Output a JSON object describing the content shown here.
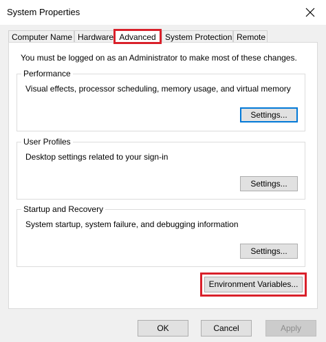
{
  "window": {
    "title": "System Properties"
  },
  "tabs": [
    {
      "label": "Computer Name"
    },
    {
      "label": "Hardware"
    },
    {
      "label": "Advanced"
    },
    {
      "label": "System Protection"
    },
    {
      "label": "Remote"
    }
  ],
  "advanced": {
    "admin_message": "You must be logged on as an Administrator to make most of these changes.",
    "performance": {
      "title": "Performance",
      "description": "Visual effects, processor scheduling, memory usage, and virtual memory",
      "button": "Settings..."
    },
    "user_profiles": {
      "title": "User Profiles",
      "description": "Desktop settings related to your sign-in",
      "button": "Settings..."
    },
    "startup_recovery": {
      "title": "Startup and Recovery",
      "description": "System startup, system failure, and debugging information",
      "button": "Settings..."
    },
    "env_button": "Environment Variables..."
  },
  "footer": {
    "ok": "OK",
    "cancel": "Cancel",
    "apply": "Apply"
  },
  "colors": {
    "highlight": "#d9202a",
    "focus": "#0078d7"
  }
}
